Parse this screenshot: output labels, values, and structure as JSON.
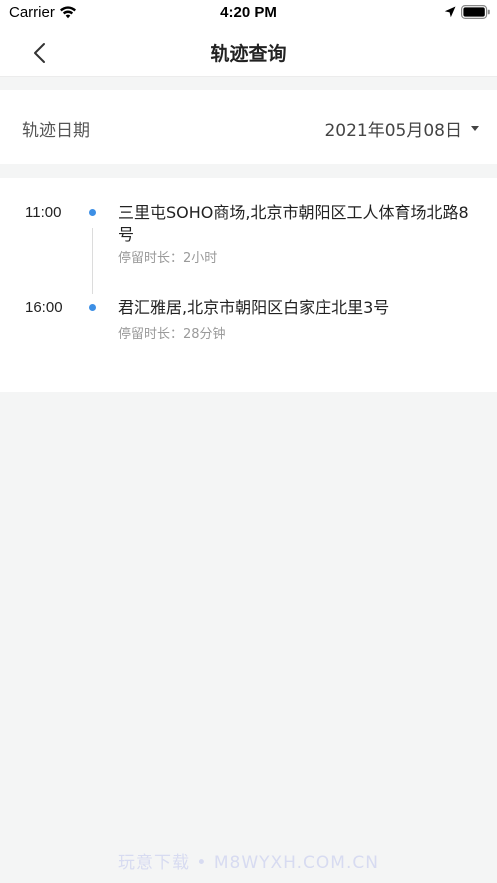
{
  "status_bar": {
    "carrier": "Carrier",
    "time": "4:20 PM",
    "icons": [
      "wifi-icon",
      "location-arrow-icon",
      "battery-icon"
    ]
  },
  "nav": {
    "back_icon": "chevron-left-icon",
    "title": "轨迹查询"
  },
  "date_row": {
    "label": "轨迹日期",
    "value": "2021年05月08日",
    "dropdown_icon": "caret-down-icon"
  },
  "tracks": [
    {
      "time": "11:00",
      "address": "三里屯SOHO商场,北京市朝阳区工人体育场北路8号",
      "duration": "停留时长：2小时"
    },
    {
      "time": "16:00",
      "address": "君汇雅居,北京市朝阳区白家庄北里3号",
      "duration": "停留时长：28分钟"
    }
  ],
  "watermark": "玩意下载 • M8WYXH.COM.CN",
  "colors": {
    "background": "#f4f5f5",
    "dot": "#3d8fe5",
    "muted_text": "#9a9a9a"
  }
}
